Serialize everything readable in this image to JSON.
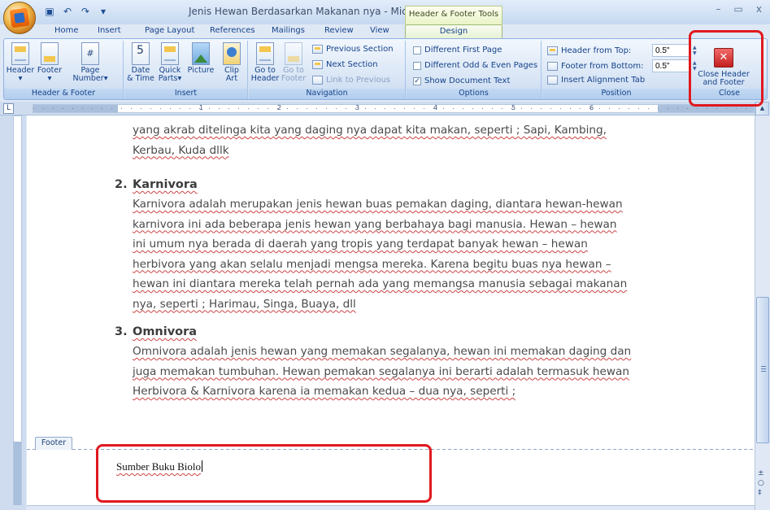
{
  "window": {
    "title": "Jenis Hewan Berdasarkan Makanan nya - Microsoft Word",
    "context_header": "Header & Footer Tools",
    "controls": [
      "–",
      "▭",
      "x"
    ]
  },
  "tabs": [
    "Home",
    "Insert",
    "Page Layout",
    "References",
    "Mailings",
    "Review",
    "View",
    "Design"
  ],
  "active_tab": "Design",
  "ribbon": {
    "header_footer": {
      "label": "Header & Footer",
      "header": "Header",
      "footer": "Footer",
      "page_number_line1": "Page",
      "page_number_line2": "Number"
    },
    "insert": {
      "label": "Insert",
      "date_line1": "Date",
      "date_line2": "& Time",
      "quick_line1": "Quick",
      "quick_line2": "Parts",
      "picture": "Picture",
      "clip_line1": "Clip",
      "clip_line2": "Art"
    },
    "navigation": {
      "label": "Navigation",
      "goto_header_line1": "Go to",
      "goto_header_line2": "Header",
      "goto_footer_line1": "Go to",
      "goto_footer_line2": "Footer",
      "previous_section": "Previous Section",
      "next_section": "Next Section",
      "link_to_previous": "Link to Previous"
    },
    "options": {
      "label": "Options",
      "different_first_page": "Different First Page",
      "different_odd_even": "Different Odd & Even Pages",
      "show_document_text": "Show Document Text",
      "show_document_text_checked": true
    },
    "position": {
      "label": "Position",
      "header_from_top": "Header from Top:",
      "header_from_top_value": "0.5\"",
      "footer_from_bottom": "Footer from Bottom:",
      "footer_from_bottom_value": "0.5\"",
      "insert_alignment_tab": "Insert Alignment Tab"
    },
    "close": {
      "label": "Close",
      "close_line1": "Close Header",
      "close_line2": "and Footer"
    }
  },
  "ruler_numbers": [
    "1",
    "2",
    "3",
    "4",
    "5",
    "6"
  ],
  "document": {
    "top_lines": [
      "yang akrab ditelinga kita yang daging nya dapat kita makan, seperti ; Sapi, Kambing,",
      "Kerbau, Kuda dllk"
    ],
    "item2": {
      "number": "2.",
      "heading": "Karnivora",
      "lines": [
        "Karnivora adalah merupakan jenis hewan buas pemakan daging, diantara hewan-hewan",
        "karnivora ini ada beberapa jenis hewan yang berbahaya bagi manusia. Hewan – hewan",
        "ini umum nya berada di daerah yang tropis yang terdapat banyak hewan – hewan",
        "herbivora yang akan selalu menjadi mengsa mereka. Karena begitu buas nya hewan –",
        "hewan ini diantara mereka telah pernah ada yang memangsa manusia sebagai makanan",
        "nya, seperti ; Harimau, Singa, Buaya, dll"
      ]
    },
    "item3": {
      "number": "3.",
      "heading": "Omnivora",
      "lines": [
        "Omnivora adalah jenis hewan yang memakan segalanya, hewan ini memakan daging dan",
        "juga memakan tumbuhan. Hewan pemakan segalanya ini berarti adalah termasuk hewan",
        "Herbivora & Karnivora karena ia memakan kedua – dua nya, seperti ;"
      ]
    },
    "footer_tab": "Footer",
    "footer_text": "Sumber Buku Biolo"
  },
  "colors": {
    "annotation_red": "#e0191f",
    "ribbon_blue": "#15428b",
    "context_green": "#e8f3c4"
  }
}
